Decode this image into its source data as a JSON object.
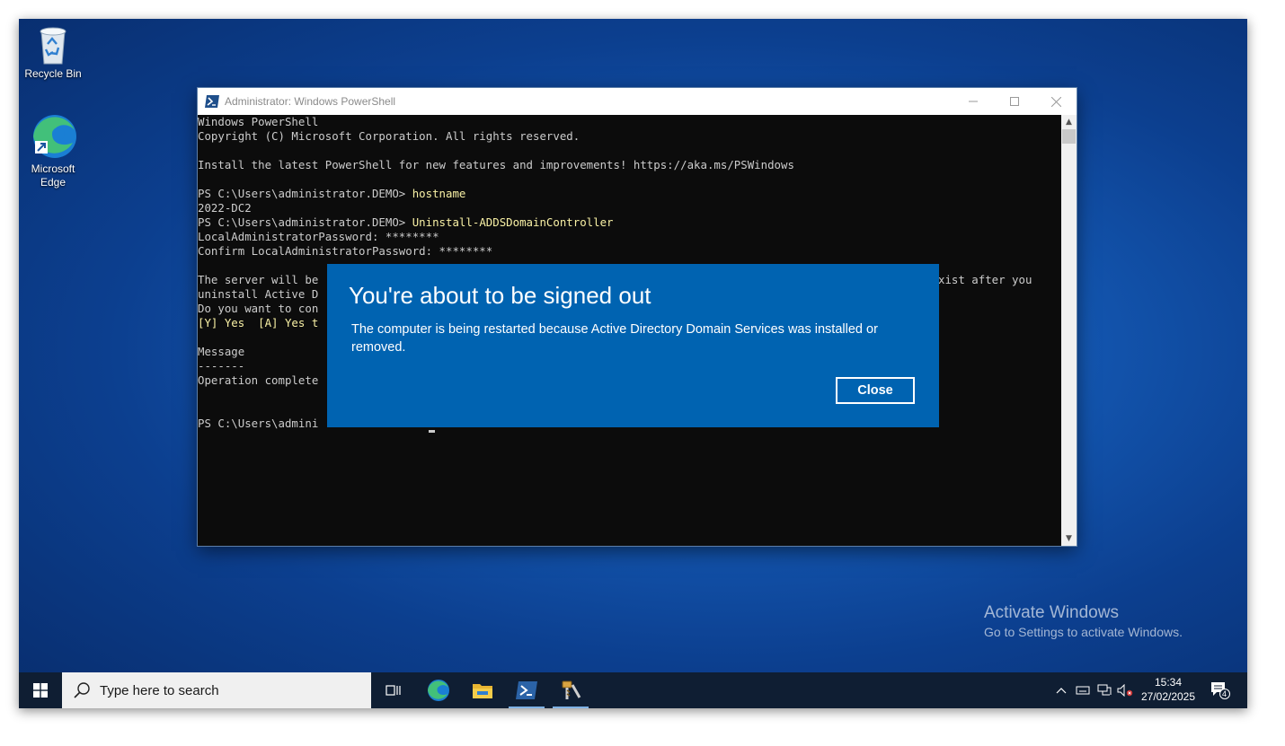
{
  "desktop": {
    "icons": [
      {
        "label": "Recycle Bin",
        "icon": "recycle-bin-icon"
      },
      {
        "label_line1": "Microsoft",
        "label_line2": "Edge",
        "icon": "edge-icon"
      }
    ]
  },
  "powershell": {
    "title": "Administrator: Windows PowerShell",
    "console": {
      "l1": "Windows PowerShell",
      "l2": "Copyright (C) Microsoft Corporation. All rights reserved.",
      "l3": "Install the latest PowerShell for new features and improvements! https://aka.ms/PSWindows",
      "l4_prompt": "PS C:\\Users\\administrator.DEMO> ",
      "l4_cmd": "hostname",
      "l5": "2022-DC2",
      "l6_prompt": "PS C:\\Users\\administrator.DEMO> ",
      "l6_cmd": "Uninstall-ADDSDomainController",
      "l7": "LocalAdministratorPassword: ********",
      "l8": "Confirm LocalAdministratorPassword: ********",
      "l9a": "The server will be",
      "l9b": "xist after you",
      "l10": "uninstall Active D",
      "l11": "Do you want to con",
      "l12": "[Y] Yes  [A] Yes t",
      "l13": "Message",
      "l14": "-------",
      "l15": "Operation complete",
      "l16": "PS C:\\Users\\admini"
    }
  },
  "dialog": {
    "title": "You're about to be signed out",
    "message": "The computer is being restarted because Active Directory Domain Services was installed or removed.",
    "close_label": "Close"
  },
  "watermark": {
    "line1": "Activate Windows",
    "line2": "Go to Settings to activate Windows."
  },
  "taskbar": {
    "search_placeholder": "Type here to search",
    "apps": [
      "task-view-icon",
      "edge-icon",
      "file-explorer-icon",
      "powershell-icon",
      "server-tools-icon"
    ],
    "clock_time": "15:34",
    "clock_date": "27/02/2025",
    "notification_count": "4"
  },
  "colors": {
    "dialog_bg": "#0063b1",
    "console_bg": "#0c0c0c",
    "console_text": "#cccccc",
    "command_text": "#f9f1a5",
    "taskbar_bg": "#0f1e33"
  }
}
